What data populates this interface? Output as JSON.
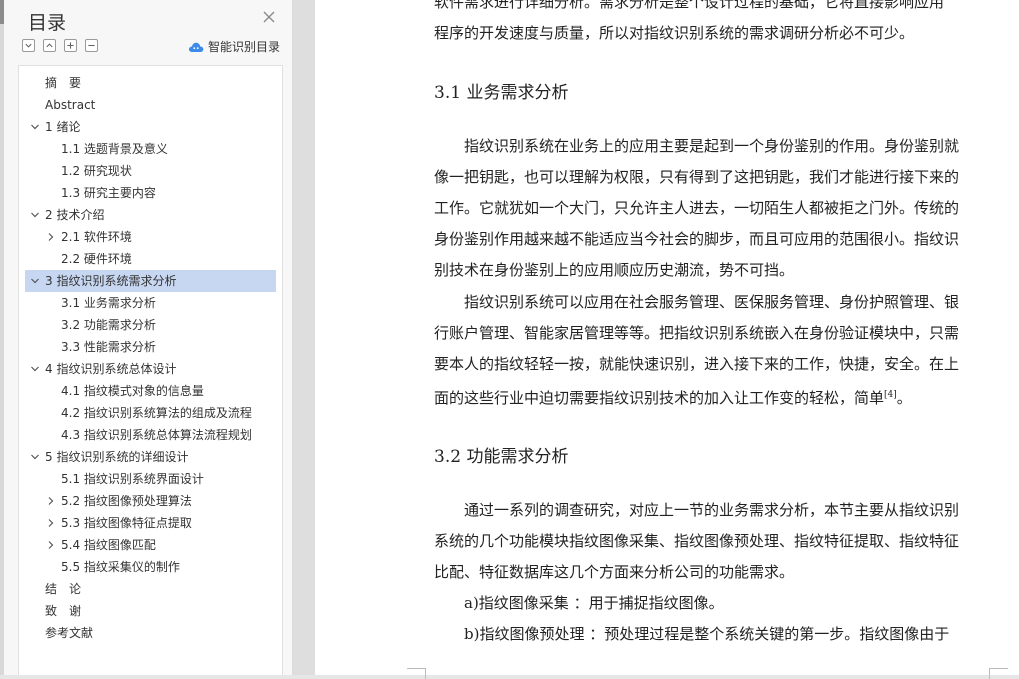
{
  "toc": {
    "title": "目录",
    "smart_toc_label": "智能识别目录",
    "items": [
      {
        "label": "摘　要",
        "level": 0,
        "arrow": ""
      },
      {
        "label": "Abstract",
        "level": 0,
        "arrow": ""
      },
      {
        "label": "1 绪论",
        "level": 0,
        "arrow": "down"
      },
      {
        "label": "1.1 选题背景及意义",
        "level": 1,
        "arrow": ""
      },
      {
        "label": "1.2 研究现状",
        "level": 1,
        "arrow": ""
      },
      {
        "label": "1.3 研究主要内容",
        "level": 1,
        "arrow": ""
      },
      {
        "label": "2 技术介绍",
        "level": 0,
        "arrow": "down"
      },
      {
        "label": "2.1 软件环境",
        "level": 1,
        "arrow": "right"
      },
      {
        "label": "2.2 硬件环境",
        "level": 1,
        "arrow": ""
      },
      {
        "label": "3 指纹识别系统需求分析",
        "level": 0,
        "arrow": "down",
        "selected": true
      },
      {
        "label": "3.1 业务需求分析",
        "level": 1,
        "arrow": ""
      },
      {
        "label": "3.2 功能需求分析",
        "level": 1,
        "arrow": ""
      },
      {
        "label": "3.3 性能需求分析",
        "level": 1,
        "arrow": ""
      },
      {
        "label": "4 指纹识别系统总体设计",
        "level": 0,
        "arrow": "down"
      },
      {
        "label": "4.1 指纹模式对象的信息量",
        "level": 1,
        "arrow": ""
      },
      {
        "label": "4.2 指纹识别系统算法的组成及流程",
        "level": 1,
        "arrow": ""
      },
      {
        "label": "4.3 指纹识别系统总体算法流程规划",
        "level": 1,
        "arrow": ""
      },
      {
        "label": "5 指纹识别系统的详细设计",
        "level": 0,
        "arrow": "down"
      },
      {
        "label": "5.1 指纹识别系统界面设计",
        "level": 1,
        "arrow": ""
      },
      {
        "label": "5.2 指纹图像预处理算法",
        "level": 1,
        "arrow": "right"
      },
      {
        "label": "5.3 指纹图像特征点提取",
        "level": 1,
        "arrow": "right"
      },
      {
        "label": "5.4 指纹图像匹配",
        "level": 1,
        "arrow": "right"
      },
      {
        "label": "5.5 指纹采集仪的制作",
        "level": 1,
        "arrow": ""
      },
      {
        "label": "结　论",
        "level": 0,
        "arrow": ""
      },
      {
        "label": "致　谢",
        "level": 0,
        "arrow": ""
      },
      {
        "label": "参考文献",
        "level": 0,
        "arrow": ""
      }
    ]
  },
  "document": {
    "top_lines": [
      "软件需求进行详细分析。需求分析是整个设计过程的基础，它将直接影响应用",
      "程序的开发速度与质量，所以对指纹识别系统的需求调研分析必不可少。"
    ],
    "h31": "3.1 业务需求分析",
    "p1": [
      "　　指纹识别系统在业务上的应用主要是起到一个身份鉴别的作用。身份鉴别就",
      "像一把钥匙，也可以理解为权限，只有得到了这把钥匙，我们才能进行接下来的",
      "工作。它就犹如一个大门，只允许主人进去，一切陌生人都被拒之门外。传统的",
      "身份鉴别作用越来越不能适应当今社会的脚步，而且可应用的范围很小。指纹识",
      "别技术在身份鉴别上的应用顺应历史潮流，势不可挡。"
    ],
    "p2": [
      "　　指纹识别系统可以应用在社会服务管理、医保服务管理、身份护照管理、银",
      "行账户管理、智能家居管理等等。把指纹识别系统嵌入在身份验证模块中，只需",
      "要本人的指纹轻轻一按，就能快速识别，进入接下来的工作，快捷，安全。在上"
    ],
    "p2_last": "面的这些行业中迫切需要指纹识别技术的加入让工作变的轻松，简单",
    "p2_cite": "[4]",
    "p2_end": "。",
    "h32": "3.2 功能需求分析",
    "p3": [
      "　　通过一系列的调查研究，对应上一节的业务需求分析，本节主要从指纹识别",
      "系统的几个功能模块指纹图像采集、指纹图像预处理、指纹特征提取、指纹特征",
      "比配、特征数据库这几个方面来分析公司的功能需求。",
      "　　a)指纹图像采集 ：用于捕捉指纹图像。",
      "　　b)指纹图像预处理 ：预处理过程是整个系统关键的第一步。指纹图像由于"
    ]
  }
}
